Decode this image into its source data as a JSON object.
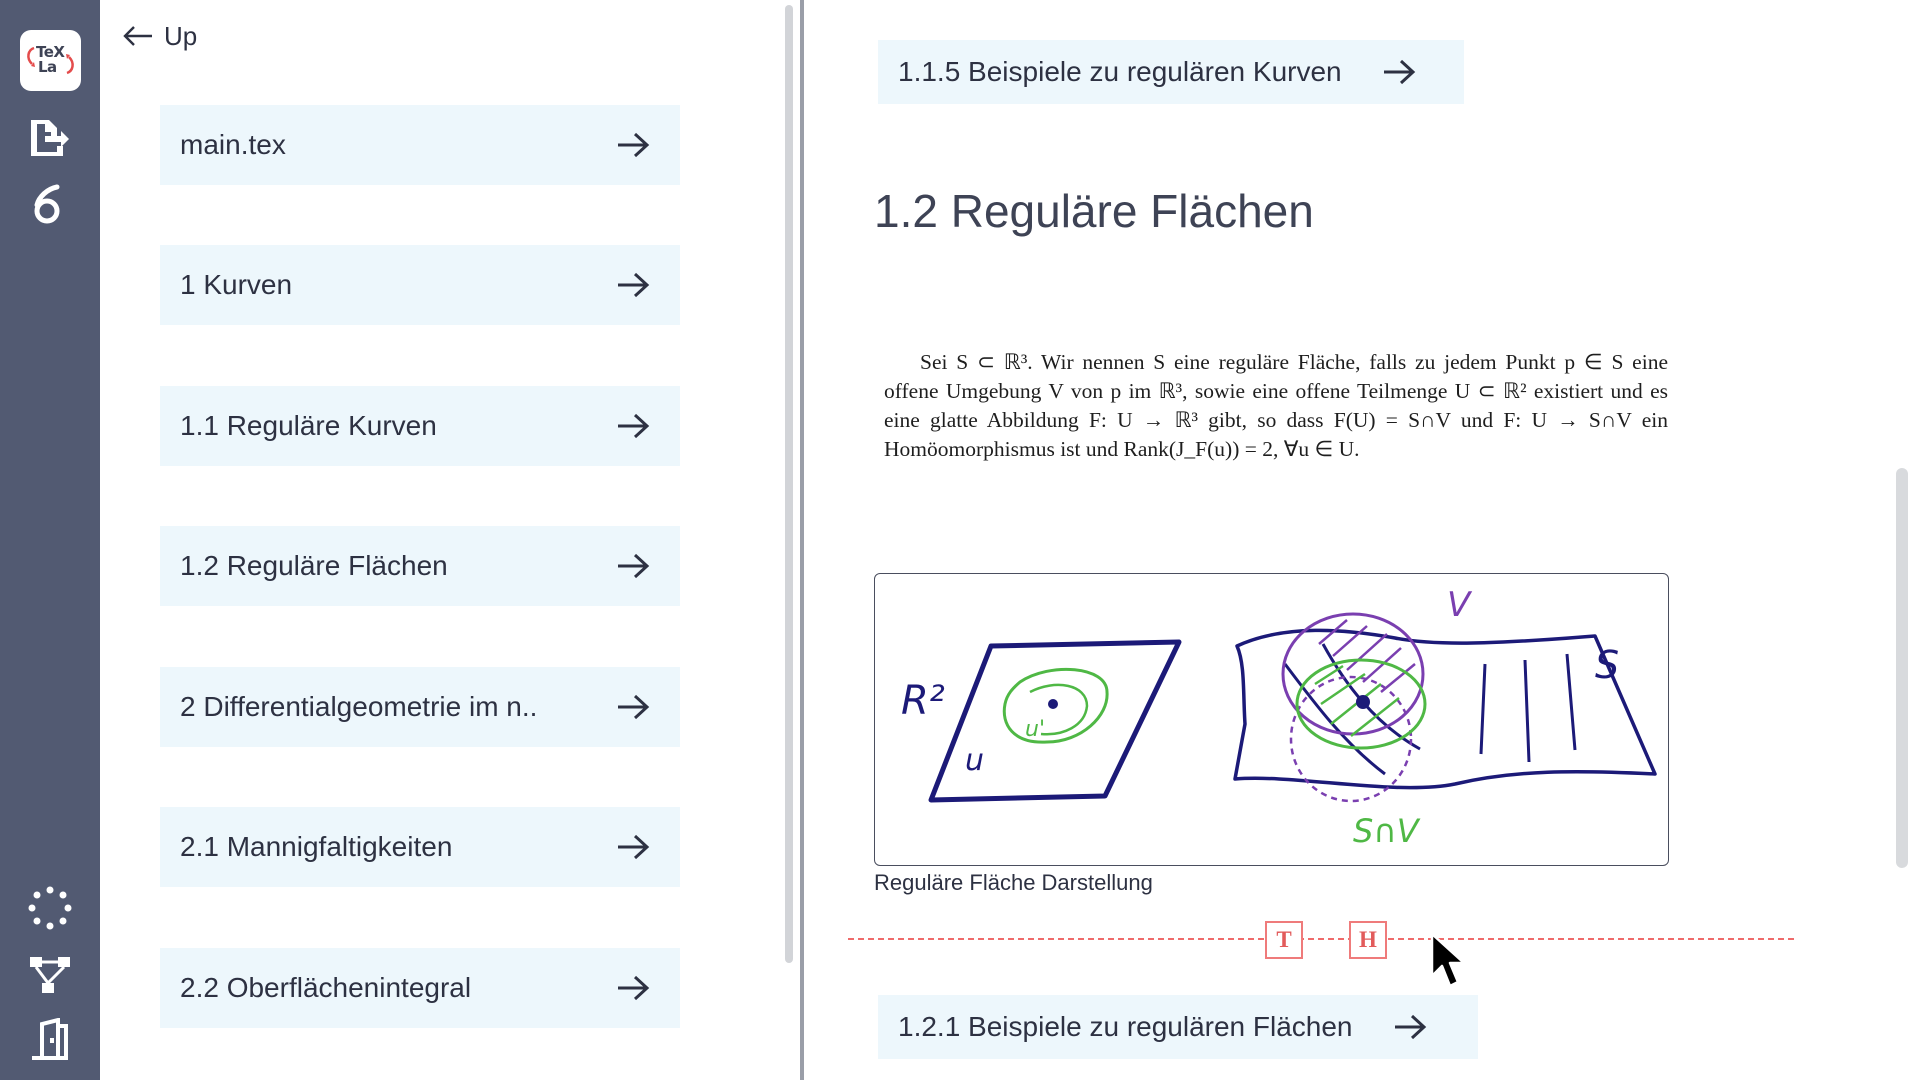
{
  "app": {
    "logo_line1": "TeX",
    "logo_line2": "La"
  },
  "rail": {
    "icons": [
      "export-icon",
      "overleaf-icon",
      "loading-dots-icon",
      "structure-tree-icon",
      "exit-icon"
    ]
  },
  "sidebar": {
    "up_label": "Up",
    "items": [
      {
        "label": "main.tex"
      },
      {
        "label": "1 Kurven"
      },
      {
        "label": "1.1 Reguläre Kurven"
      },
      {
        "label": "1.2 Reguläre Flächen"
      },
      {
        "label": "2 Differentialgeometrie im n.."
      },
      {
        "label": "2.1 Mannigfaltigkeiten"
      },
      {
        "label": "2.2 Oberflächenintegral"
      }
    ]
  },
  "main": {
    "prev_link": "1.1.5 Beispiele zu regulären Kurven",
    "section_title": "1.2 Reguläre Flächen",
    "math_text": "Sei S ⊂ ℝ³. Wir nennen S eine reguläre Fläche, falls zu jedem Punkt p ∈ S eine offene Umgebung V von p im ℝ³, sowie eine offene Teilmenge U ⊂ ℝ² existiert und es eine glatte Abbildung F: U → ℝ³ gibt, so dass F(U) = S∩V und F: U → S∩V ein Homöomorphismus ist und Rank(J_F(u)) = 2, ∀u ∈ U.",
    "figure_labels": {
      "r2": "R²",
      "u": "u",
      "u_prime": "u'",
      "v": "V",
      "s": "S",
      "s_cap_v": "S∩V"
    },
    "figure_caption": "Reguläre Fläche Darstellung",
    "insert_text_button": "T",
    "insert_heading_button": "H",
    "next_link": "1.2.1 Beispiele zu regulären Flächen"
  },
  "colors": {
    "rail": "#525a72",
    "card": "#edf7fc",
    "accent_red": "#ef6b6b",
    "ink_navy": "#1c1a78",
    "ink_green": "#4fb845",
    "ink_purple": "#7a3fb0"
  }
}
